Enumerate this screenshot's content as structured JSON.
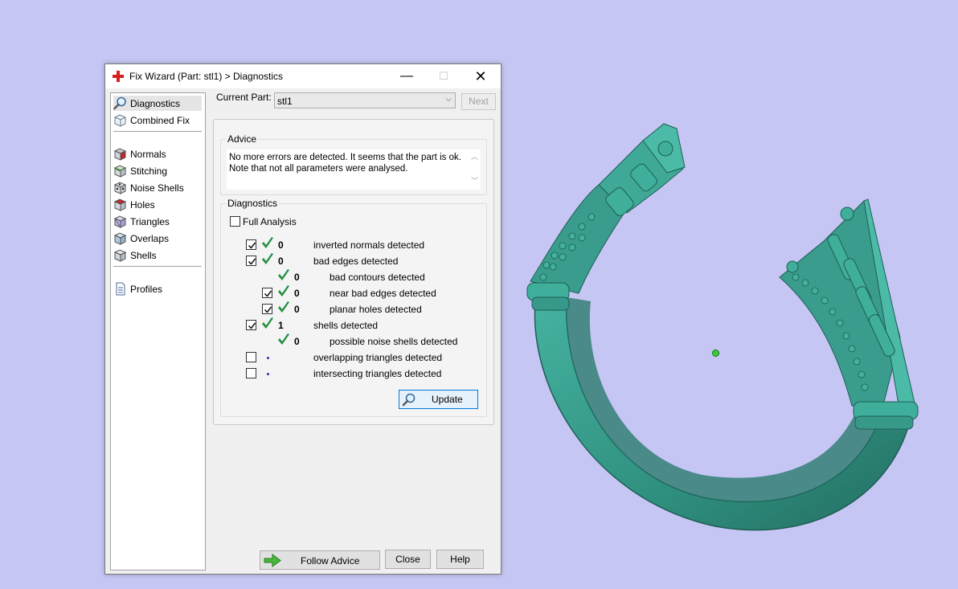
{
  "window": {
    "title": "Fix Wizard (Part: stl1) > Diagnostics",
    "minimize_symbol": "—",
    "maximize_symbol": "☐",
    "close_symbol": "✕"
  },
  "nav": {
    "items": [
      {
        "label": "Diagnostics",
        "icon": "magnifier-icon",
        "selected": true
      },
      {
        "label": "Combined Fix",
        "icon": "cube-outline-icon"
      },
      {
        "label": "Normals",
        "icon": "cube-red-icon"
      },
      {
        "label": "Stitching",
        "icon": "cube-green-icon"
      },
      {
        "label": "Noise Shells",
        "icon": "dice-icon"
      },
      {
        "label": "Holes",
        "icon": "cube-hole-icon"
      },
      {
        "label": "Triangles",
        "icon": "cube-purple-icon"
      },
      {
        "label": "Overlaps",
        "icon": "cube-blue-icon"
      },
      {
        "label": "Shells",
        "icon": "cube-grey-icon"
      },
      {
        "label": "Profiles",
        "icon": "document-icon"
      }
    ]
  },
  "header": {
    "current_part_label": "Current Part:",
    "current_part_value": "stl1",
    "next_label": "Next"
  },
  "advice": {
    "title": "Advice",
    "line1": "No more errors are detected. It seems that the part is ok.",
    "line2": "Note that not all parameters were analysed."
  },
  "diagnostics": {
    "title": "Diagnostics",
    "full_analysis_label": "Full Analysis",
    "full_analysis_checked": false,
    "rows": [
      {
        "count": "0",
        "label": "inverted normals detected",
        "checked": true,
        "indent": 0,
        "status": "ok"
      },
      {
        "count": "0",
        "label": "bad edges detected",
        "checked": true,
        "indent": 0,
        "status": "ok"
      },
      {
        "count": "0",
        "label": "bad contours detected",
        "checked": null,
        "indent": 1,
        "status": "ok"
      },
      {
        "count": "0",
        "label": "near bad edges detected",
        "checked": true,
        "indent": 1,
        "status": "ok"
      },
      {
        "count": "0",
        "label": "planar holes detected",
        "checked": true,
        "indent": 1,
        "status": "ok"
      },
      {
        "count": "1",
        "label": "shells detected",
        "checked": true,
        "indent": 0,
        "status": "ok"
      },
      {
        "count": "0",
        "label": "possible noise shells detected",
        "checked": null,
        "indent": 1,
        "status": "ok"
      },
      {
        "count": "",
        "label": "overlapping triangles detected",
        "checked": false,
        "indent": 0,
        "status": "none"
      },
      {
        "count": "",
        "label": "intersecting triangles detected",
        "checked": false,
        "indent": 0,
        "status": "none"
      }
    ],
    "update_label": "Update"
  },
  "footer": {
    "follow_advice_label": "Follow Advice",
    "close_label": "Close",
    "help_label": "Help"
  },
  "colors": {
    "background": "#c6c6f4",
    "model": "#3a9c8c",
    "tick_green": "#1f8f3a"
  }
}
